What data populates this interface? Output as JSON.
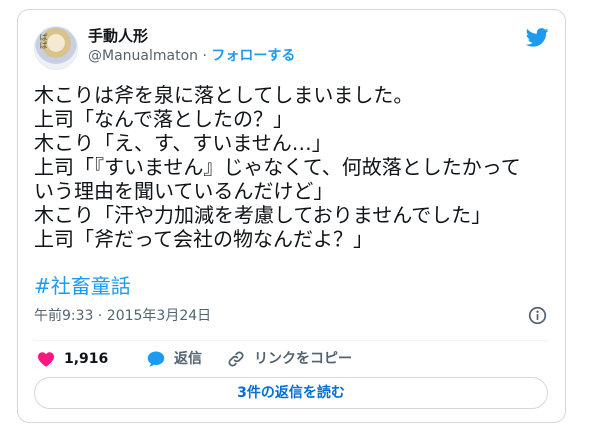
{
  "author": {
    "display_name": "手動人形",
    "handle": "@Manualmaton",
    "separator": "·",
    "follow_label": "フォローする",
    "avatar_text": "ぱぱ"
  },
  "tweet": {
    "lines": [
      "木こりは斧を泉に落としてしまいました。",
      "上司「なんで落としたの？」",
      "木こり「え、す、すいません…」",
      "上司「『すいません』じゃなくて、何故落としたかって",
      "いう理由を聞いているんだけど」",
      "木こり「汗や力加減を考慮しておりませんでした」",
      "上司「斧だって会社の物なんだよ？」"
    ],
    "hashtag": "#社畜童話"
  },
  "meta": {
    "timestamp": "午前9:33 · 2015年3月24日"
  },
  "actions": {
    "like_count": "1,916",
    "reply_label": "返信",
    "copy_link_label": "リンクをコピー"
  },
  "more_replies_label": "3件の返信を読む",
  "colors": {
    "accent": "#1d9bf0",
    "like": "#f91880",
    "text": "#0f1419",
    "secondary": "#536471",
    "border": "#cfd9de"
  },
  "icons": {
    "brand": "twitter-bird-icon",
    "info": "info-icon",
    "like": "heart-icon",
    "reply": "speech-bubble-icon",
    "copy": "link-icon"
  }
}
